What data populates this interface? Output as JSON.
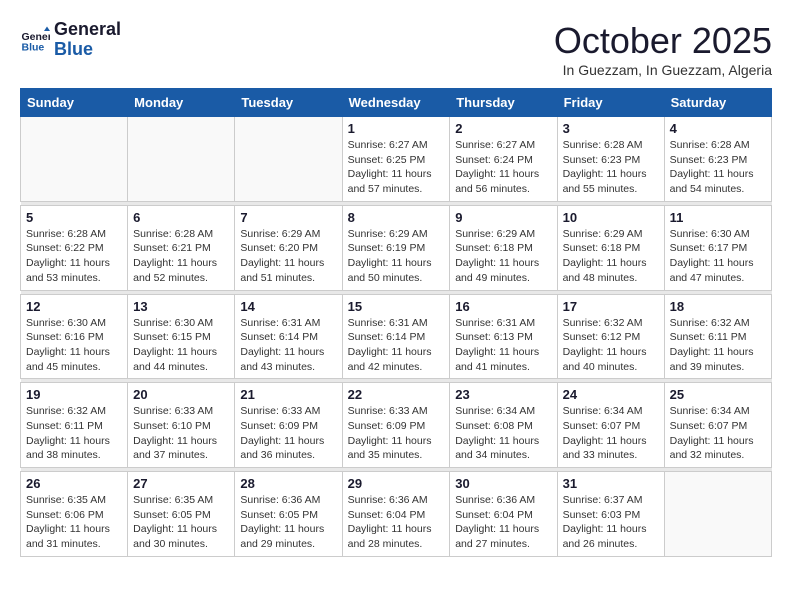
{
  "logo": {
    "line1": "General",
    "line2": "Blue"
  },
  "title": "October 2025",
  "subtitle": "In Guezzam, In Guezzam, Algeria",
  "days_of_week": [
    "Sunday",
    "Monday",
    "Tuesday",
    "Wednesday",
    "Thursday",
    "Friday",
    "Saturday"
  ],
  "weeks": [
    [
      {
        "day": "",
        "info": ""
      },
      {
        "day": "",
        "info": ""
      },
      {
        "day": "",
        "info": ""
      },
      {
        "day": "1",
        "info": "Sunrise: 6:27 AM\nSunset: 6:25 PM\nDaylight: 11 hours and 57 minutes."
      },
      {
        "day": "2",
        "info": "Sunrise: 6:27 AM\nSunset: 6:24 PM\nDaylight: 11 hours and 56 minutes."
      },
      {
        "day": "3",
        "info": "Sunrise: 6:28 AM\nSunset: 6:23 PM\nDaylight: 11 hours and 55 minutes."
      },
      {
        "day": "4",
        "info": "Sunrise: 6:28 AM\nSunset: 6:23 PM\nDaylight: 11 hours and 54 minutes."
      }
    ],
    [
      {
        "day": "5",
        "info": "Sunrise: 6:28 AM\nSunset: 6:22 PM\nDaylight: 11 hours and 53 minutes."
      },
      {
        "day": "6",
        "info": "Sunrise: 6:28 AM\nSunset: 6:21 PM\nDaylight: 11 hours and 52 minutes."
      },
      {
        "day": "7",
        "info": "Sunrise: 6:29 AM\nSunset: 6:20 PM\nDaylight: 11 hours and 51 minutes."
      },
      {
        "day": "8",
        "info": "Sunrise: 6:29 AM\nSunset: 6:19 PM\nDaylight: 11 hours and 50 minutes."
      },
      {
        "day": "9",
        "info": "Sunrise: 6:29 AM\nSunset: 6:18 PM\nDaylight: 11 hours and 49 minutes."
      },
      {
        "day": "10",
        "info": "Sunrise: 6:29 AM\nSunset: 6:18 PM\nDaylight: 11 hours and 48 minutes."
      },
      {
        "day": "11",
        "info": "Sunrise: 6:30 AM\nSunset: 6:17 PM\nDaylight: 11 hours and 47 minutes."
      }
    ],
    [
      {
        "day": "12",
        "info": "Sunrise: 6:30 AM\nSunset: 6:16 PM\nDaylight: 11 hours and 45 minutes."
      },
      {
        "day": "13",
        "info": "Sunrise: 6:30 AM\nSunset: 6:15 PM\nDaylight: 11 hours and 44 minutes."
      },
      {
        "day": "14",
        "info": "Sunrise: 6:31 AM\nSunset: 6:14 PM\nDaylight: 11 hours and 43 minutes."
      },
      {
        "day": "15",
        "info": "Sunrise: 6:31 AM\nSunset: 6:14 PM\nDaylight: 11 hours and 42 minutes."
      },
      {
        "day": "16",
        "info": "Sunrise: 6:31 AM\nSunset: 6:13 PM\nDaylight: 11 hours and 41 minutes."
      },
      {
        "day": "17",
        "info": "Sunrise: 6:32 AM\nSunset: 6:12 PM\nDaylight: 11 hours and 40 minutes."
      },
      {
        "day": "18",
        "info": "Sunrise: 6:32 AM\nSunset: 6:11 PM\nDaylight: 11 hours and 39 minutes."
      }
    ],
    [
      {
        "day": "19",
        "info": "Sunrise: 6:32 AM\nSunset: 6:11 PM\nDaylight: 11 hours and 38 minutes."
      },
      {
        "day": "20",
        "info": "Sunrise: 6:33 AM\nSunset: 6:10 PM\nDaylight: 11 hours and 37 minutes."
      },
      {
        "day": "21",
        "info": "Sunrise: 6:33 AM\nSunset: 6:09 PM\nDaylight: 11 hours and 36 minutes."
      },
      {
        "day": "22",
        "info": "Sunrise: 6:33 AM\nSunset: 6:09 PM\nDaylight: 11 hours and 35 minutes."
      },
      {
        "day": "23",
        "info": "Sunrise: 6:34 AM\nSunset: 6:08 PM\nDaylight: 11 hours and 34 minutes."
      },
      {
        "day": "24",
        "info": "Sunrise: 6:34 AM\nSunset: 6:07 PM\nDaylight: 11 hours and 33 minutes."
      },
      {
        "day": "25",
        "info": "Sunrise: 6:34 AM\nSunset: 6:07 PM\nDaylight: 11 hours and 32 minutes."
      }
    ],
    [
      {
        "day": "26",
        "info": "Sunrise: 6:35 AM\nSunset: 6:06 PM\nDaylight: 11 hours and 31 minutes."
      },
      {
        "day": "27",
        "info": "Sunrise: 6:35 AM\nSunset: 6:05 PM\nDaylight: 11 hours and 30 minutes."
      },
      {
        "day": "28",
        "info": "Sunrise: 6:36 AM\nSunset: 6:05 PM\nDaylight: 11 hours and 29 minutes."
      },
      {
        "day": "29",
        "info": "Sunrise: 6:36 AM\nSunset: 6:04 PM\nDaylight: 11 hours and 28 minutes."
      },
      {
        "day": "30",
        "info": "Sunrise: 6:36 AM\nSunset: 6:04 PM\nDaylight: 11 hours and 27 minutes."
      },
      {
        "day": "31",
        "info": "Sunrise: 6:37 AM\nSunset: 6:03 PM\nDaylight: 11 hours and 26 minutes."
      },
      {
        "day": "",
        "info": ""
      }
    ]
  ]
}
